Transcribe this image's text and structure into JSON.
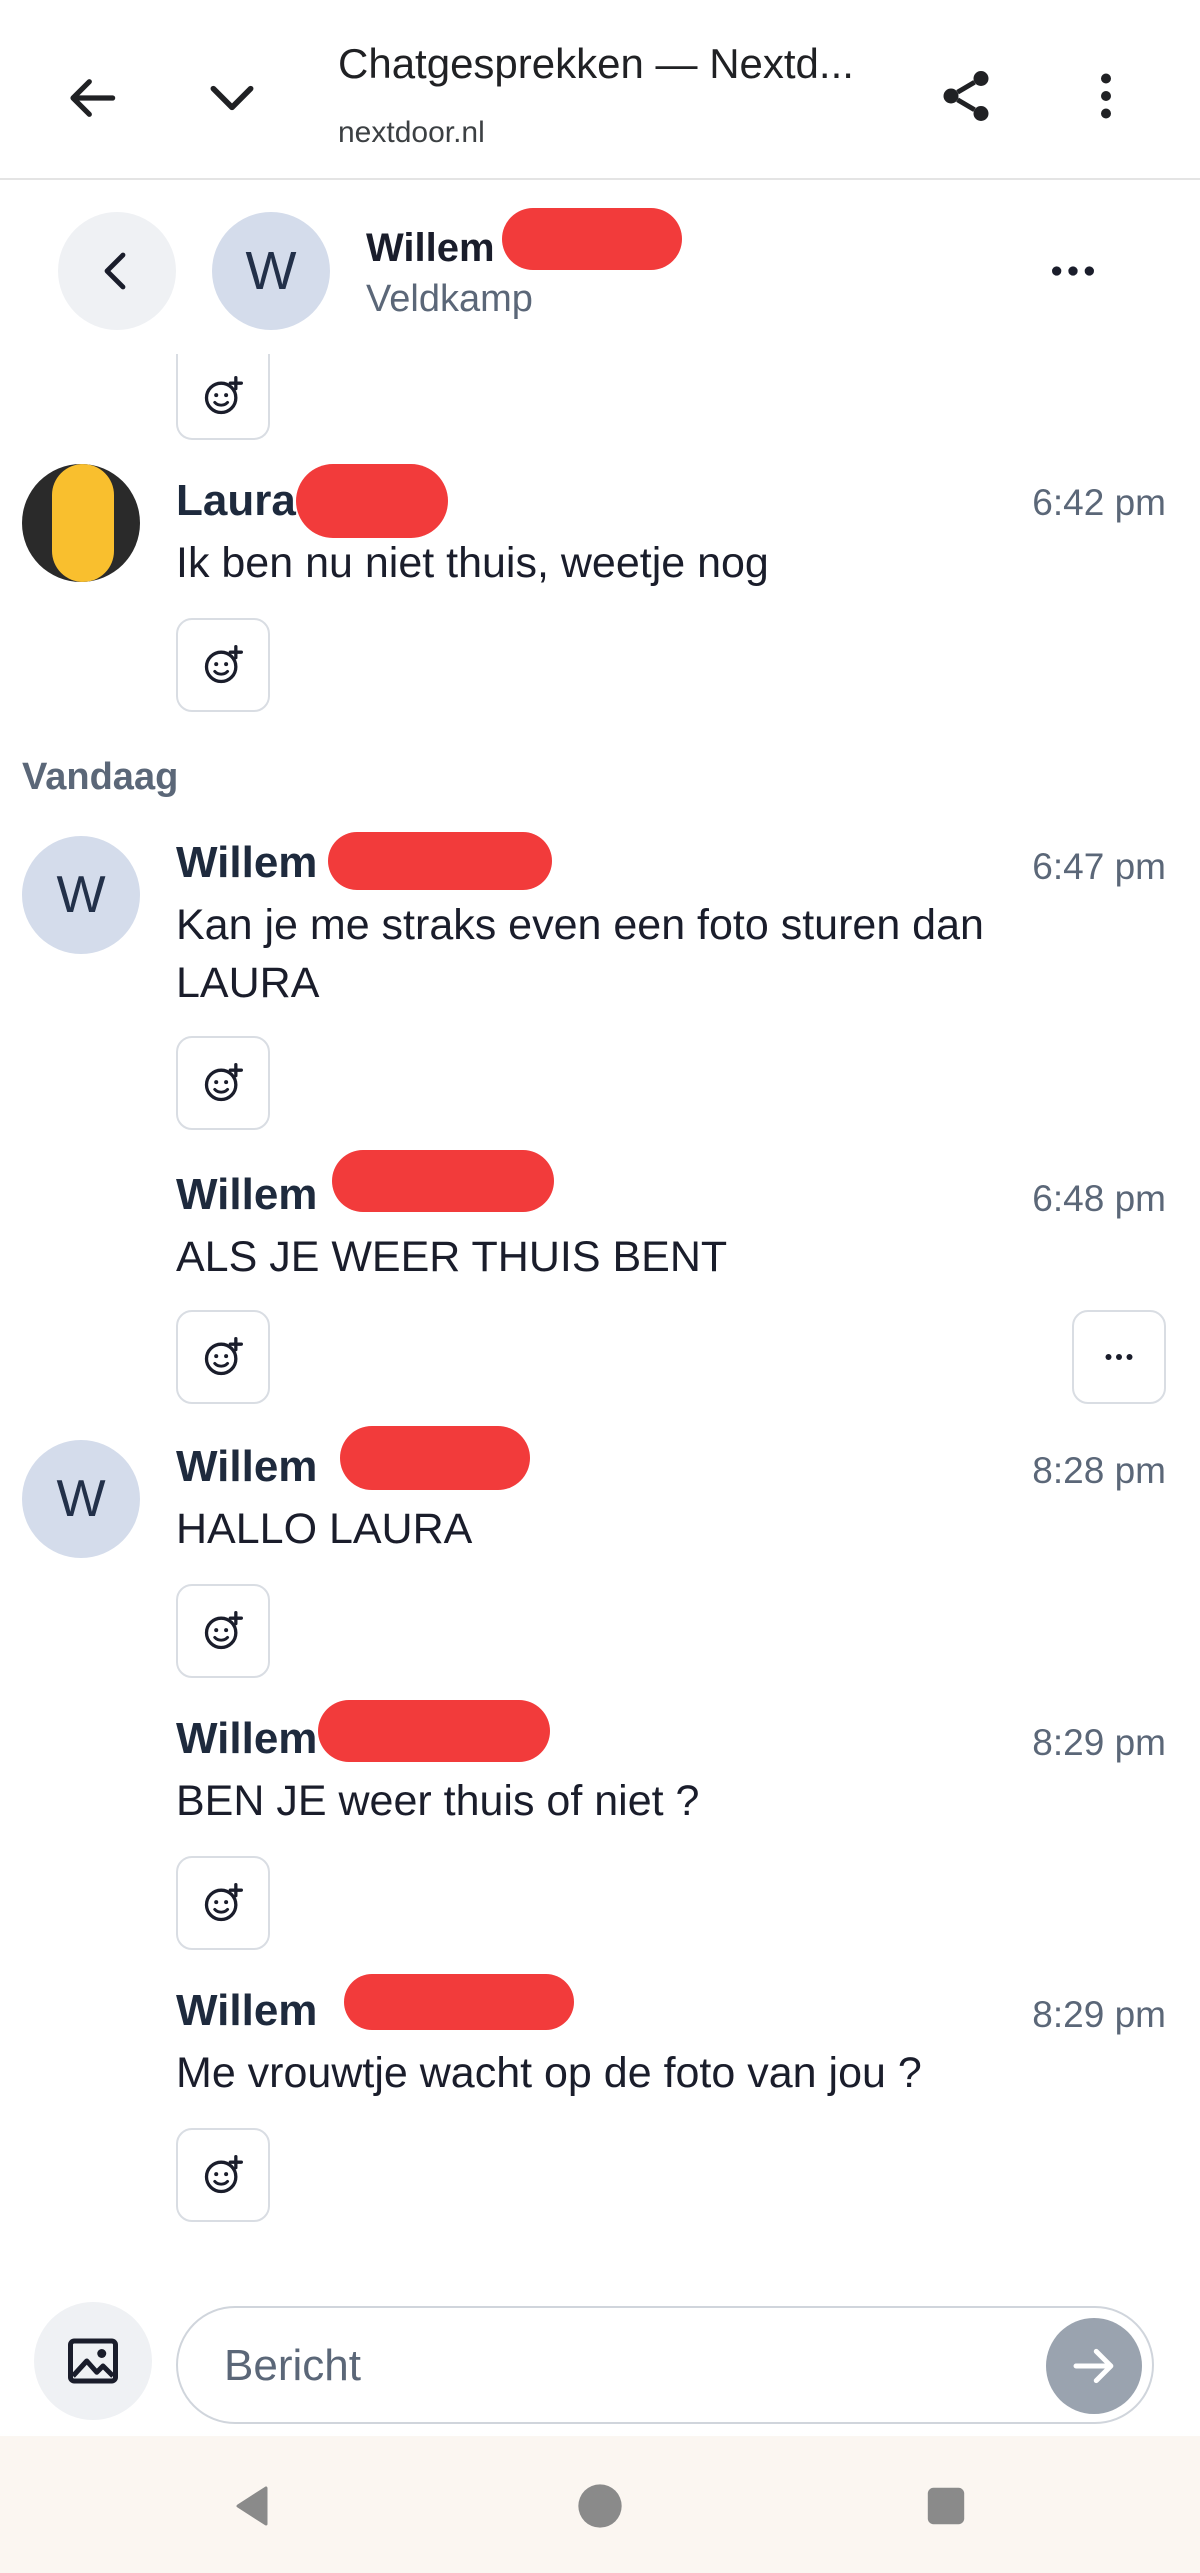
{
  "browser": {
    "title": "Chatgesprekken — Nextd...",
    "url": "nextdoor.nl"
  },
  "chat_header": {
    "avatar_initial": "W",
    "name": "Willem",
    "subtitle": "Veldkamp"
  },
  "messages_top": [
    {
      "sender": "Laura",
      "time": "6:42 pm",
      "text": "Ik ben nu niet thuis, weetje nog"
    }
  ],
  "day_separator": "Vandaag",
  "messages_today": [
    {
      "avatar_initial": "W",
      "sender": "Willem",
      "time": "6:47 pm",
      "text": "Kan je me straks even een foto sturen dan LAURA"
    },
    {
      "sender": "Willem",
      "time": "6:48 pm",
      "text": "ALS JE WEER THUIS BENT"
    },
    {
      "avatar_initial": "W",
      "sender": "Willem",
      "time": "8:28 pm",
      "text": "HALLO LAURA"
    },
    {
      "sender": "Willem",
      "time": "8:29 pm",
      "text": "BEN JE weer thuis of niet ?"
    },
    {
      "sender": "Willem",
      "time": "8:29 pm",
      "text": "Me vrouwtje wacht op de foto van jou ?"
    }
  ],
  "composer": {
    "placeholder": "Bericht"
  },
  "icons": {
    "back": "arrow-left-icon",
    "collapse": "chevron-down-icon",
    "share": "share-icon",
    "menu": "more-vertical-icon",
    "chat_back": "chevron-left-icon",
    "chat_more": "more-horizontal-icon",
    "reaction": "add-reaction-icon",
    "image": "image-icon",
    "send": "send-arrow-icon"
  },
  "colors": {
    "accent_avatar": "#d4dceb",
    "send_disabled": "#9aa3af",
    "redaction": "#f23b3b"
  }
}
